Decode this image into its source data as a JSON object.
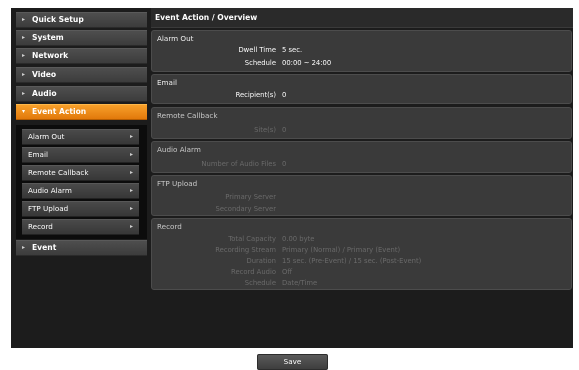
{
  "sidebar": {
    "items": [
      {
        "label": "Quick Setup"
      },
      {
        "label": "System"
      },
      {
        "label": "Network"
      },
      {
        "label": "Video"
      },
      {
        "label": "Audio"
      },
      {
        "label": "Event Action"
      },
      {
        "label": "Event"
      }
    ],
    "submenu": [
      {
        "label": "Alarm Out"
      },
      {
        "label": "Email"
      },
      {
        "label": "Remote Callback"
      },
      {
        "label": "Audio Alarm"
      },
      {
        "label": "FTP Upload"
      },
      {
        "label": "Record"
      }
    ],
    "active_color": "#F28C1A"
  },
  "main": {
    "title": "Event Action / Overview",
    "alarm_out": {
      "title": "Alarm Out",
      "rows": [
        {
          "key": "Dwell Time",
          "value": "5 sec."
        },
        {
          "key": "Schedule",
          "value": "00:00 ~ 24:00"
        }
      ]
    },
    "email": {
      "title": "Email",
      "rows": [
        {
          "key": "Recipient(s)",
          "value": "0"
        }
      ]
    },
    "remote_callback": {
      "title": "Remote Callback",
      "rows": [
        {
          "key": "Site(s)",
          "value": "0"
        }
      ]
    },
    "audio_alarm": {
      "title": "Audio Alarm",
      "rows": [
        {
          "key": "Number of Audio Files",
          "value": "0"
        }
      ]
    },
    "ftp_upload": {
      "title": "FTP Upload",
      "rows": [
        {
          "key": "Primary Server",
          "value": ""
        },
        {
          "key": "Secondary Server",
          "value": ""
        }
      ]
    },
    "record": {
      "title": "Record",
      "rows": [
        {
          "key": "Total Capacity",
          "value": "0.00 byte"
        },
        {
          "key": "Recording Stream",
          "value": "Primary (Normal) / Primary (Event)"
        },
        {
          "key": "Duration",
          "value": "15 sec. (Pre-Event) / 15 sec. (Post-Event)"
        },
        {
          "key": "Record Audio",
          "value": "Off"
        },
        {
          "key": "Schedule",
          "value": "Date/Time"
        }
      ]
    }
  },
  "footer": {
    "save_label": "Save"
  }
}
